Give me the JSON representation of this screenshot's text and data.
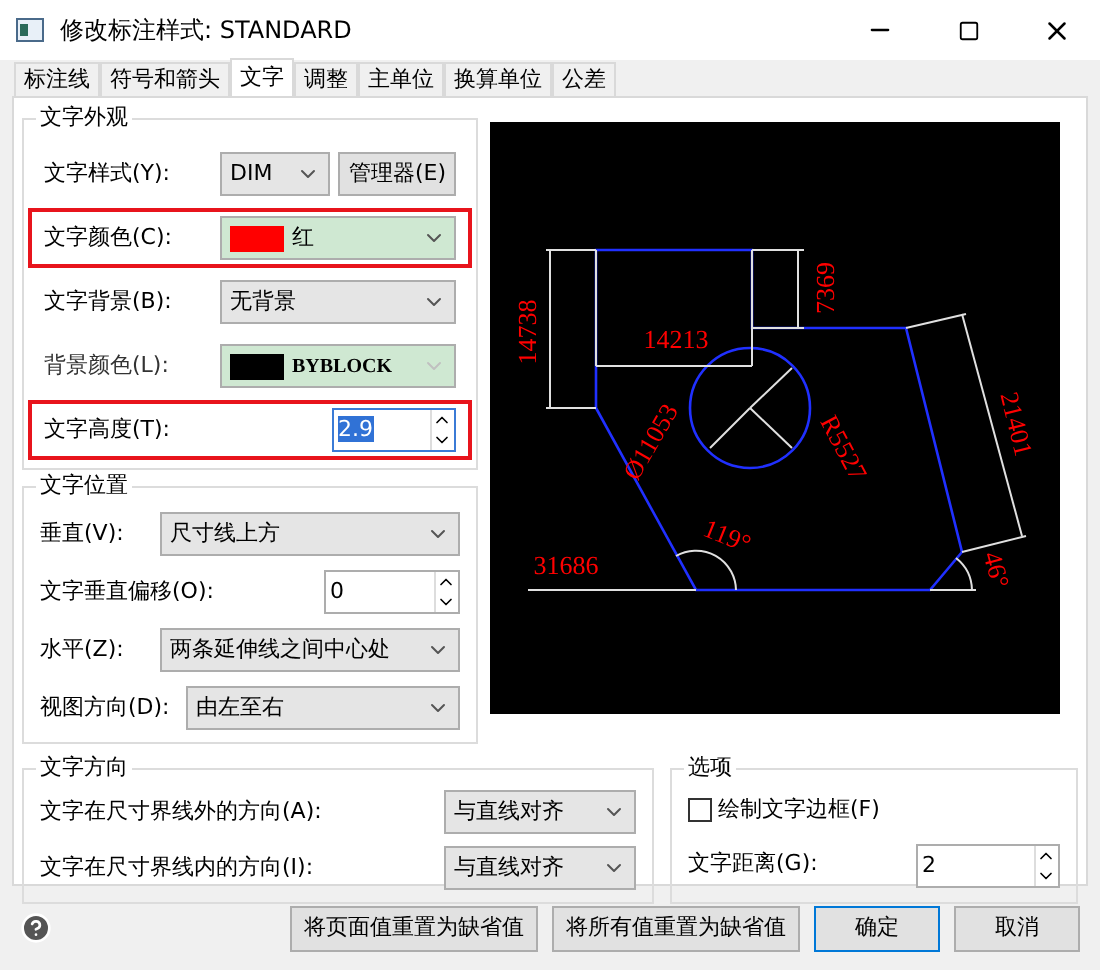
{
  "window": {
    "title": "修改标注样式: STANDARD"
  },
  "tabs": [
    {
      "label": "标注线",
      "selected": false
    },
    {
      "label": "符号和箭头",
      "selected": false
    },
    {
      "label": "文字",
      "selected": true
    },
    {
      "label": "调整",
      "selected": false
    },
    {
      "label": "主单位",
      "selected": false
    },
    {
      "label": "换算单位",
      "selected": false
    },
    {
      "label": "公差",
      "selected": false
    }
  ],
  "appearance": {
    "title": "文字外观",
    "rows": [
      {
        "label": "文字样式(Y):",
        "kind": "select",
        "value": "DIM",
        "button": "管理器(E)",
        "highlighted": false,
        "disabled": false,
        "focused": false
      },
      {
        "label": "文字颜色(C):",
        "kind": "color",
        "value": "红",
        "color": "#ff0000",
        "highlighted": true,
        "disabled": false,
        "focused": false
      },
      {
        "label": "文字背景(B):",
        "kind": "select",
        "value": "无背景",
        "highlighted": false,
        "disabled": false,
        "focused": false
      },
      {
        "label": "背景颜色(L):",
        "kind": "color",
        "value": "BYBLOCK",
        "color": "#000000",
        "highlighted": false,
        "disabled": true,
        "focused": false
      },
      {
        "label": "文字高度(T):",
        "kind": "spin",
        "value": "2.9",
        "highlighted": true,
        "disabled": false,
        "focused": true
      }
    ]
  },
  "placement": {
    "title": "文字位置",
    "rows": [
      {
        "label": "垂直(V):",
        "kind": "select",
        "value": "尺寸线上方"
      },
      {
        "label": "文字垂直偏移(O):",
        "kind": "spin",
        "value": "0"
      },
      {
        "label": "水平(Z):",
        "kind": "select",
        "value": "两条延伸线之间中心处"
      },
      {
        "label": "视图方向(D):",
        "kind": "select",
        "value": "由左至右"
      }
    ]
  },
  "preview": {
    "labels": [
      "14738",
      "14213",
      "7369",
      "21401",
      "Ø11053",
      "R5527",
      "119°",
      "31686",
      "46°"
    ]
  },
  "direction": {
    "title": "文字方向",
    "rows": [
      {
        "label": "文字在尺寸界线外的方向(A):",
        "value": "与直线对齐"
      },
      {
        "label": "文字在尺寸界线内的方向(I):",
        "value": "与直线对齐"
      }
    ]
  },
  "options": {
    "title": "选项",
    "checkbox": {
      "label": "绘制文字边框(F)",
      "checked": false
    },
    "distance": {
      "label": "文字距离(G):",
      "value": "2"
    }
  },
  "footer": {
    "buttons": [
      {
        "label": "将页面值重置为缺省值",
        "kind": "normal"
      },
      {
        "label": "将所有值重置为缺省值",
        "kind": "normal"
      },
      {
        "label": "确定",
        "kind": "default"
      },
      {
        "label": "取消",
        "kind": "normal"
      }
    ]
  }
}
